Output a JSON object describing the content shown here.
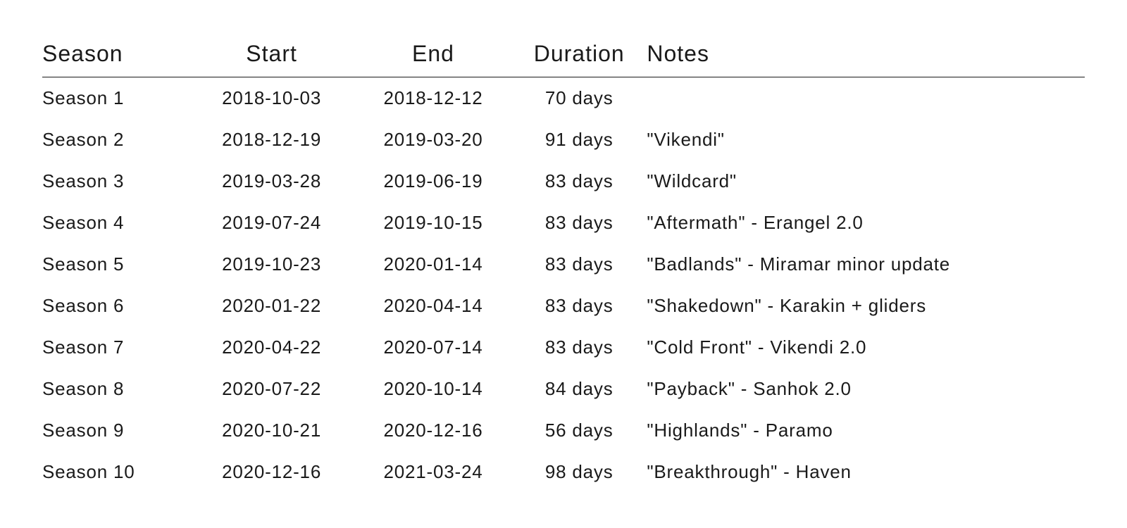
{
  "chart_data": {
    "type": "table",
    "columns": [
      "Season",
      "Start",
      "End",
      "Duration",
      "Notes"
    ],
    "rows": [
      [
        "Season 1",
        "2018-10-03",
        "2018-12-12",
        "70 days",
        ""
      ],
      [
        "Season 2",
        "2018-12-19",
        "2019-03-20",
        "91 days",
        "\"Vikendi\""
      ],
      [
        "Season 3",
        "2019-03-28",
        "2019-06-19",
        "83 days",
        "\"Wildcard\""
      ],
      [
        "Season 4",
        "2019-07-24",
        "2019-10-15",
        "83 days",
        "\"Aftermath\" - Erangel 2.0"
      ],
      [
        "Season 5",
        "2019-10-23",
        "2020-01-14",
        "83 days",
        "\"Badlands\" - Miramar minor update"
      ],
      [
        "Season 6",
        "2020-01-22",
        "2020-04-14",
        "83 days",
        "\"Shakedown\" - Karakin + gliders"
      ],
      [
        "Season 7",
        "2020-04-22",
        "2020-07-14",
        "83 days",
        "\"Cold Front\" - Vikendi 2.0"
      ],
      [
        "Season 8",
        "2020-07-22",
        "2020-10-14",
        "84 days",
        "\"Payback\" - Sanhok 2.0"
      ],
      [
        "Season 9",
        "2020-10-21",
        "2020-12-16",
        "56 days",
        "\"Highlands\" - Paramo"
      ],
      [
        "Season 10",
        "2020-12-16",
        "2021-03-24",
        "98 days",
        "\"Breakthrough\" - Haven"
      ]
    ]
  },
  "headers": {
    "season": "Season",
    "start": "Start",
    "end": "End",
    "duration": "Duration",
    "notes": "Notes"
  },
  "rows": [
    {
      "season": "Season 1",
      "start": "2018-10-03",
      "end": "2018-12-12",
      "duration": "70 days",
      "notes": ""
    },
    {
      "season": "Season 2",
      "start": "2018-12-19",
      "end": "2019-03-20",
      "duration": "91 days",
      "notes": "\"Vikendi\""
    },
    {
      "season": "Season 3",
      "start": "2019-03-28",
      "end": "2019-06-19",
      "duration": "83 days",
      "notes": "\"Wildcard\""
    },
    {
      "season": "Season 4",
      "start": "2019-07-24",
      "end": "2019-10-15",
      "duration": "83 days",
      "notes": "\"Aftermath\" - Erangel 2.0"
    },
    {
      "season": "Season 5",
      "start": "2019-10-23",
      "end": "2020-01-14",
      "duration": "83 days",
      "notes": "\"Badlands\" - Miramar minor update"
    },
    {
      "season": "Season 6",
      "start": "2020-01-22",
      "end": "2020-04-14",
      "duration": "83 days",
      "notes": "\"Shakedown\" - Karakin + gliders"
    },
    {
      "season": "Season 7",
      "start": "2020-04-22",
      "end": "2020-07-14",
      "duration": "83 days",
      "notes": "\"Cold Front\" - Vikendi 2.0"
    },
    {
      "season": "Season 8",
      "start": "2020-07-22",
      "end": "2020-10-14",
      "duration": "84 days",
      "notes": "\"Payback\" - Sanhok 2.0"
    },
    {
      "season": "Season 9",
      "start": "2020-10-21",
      "end": "2020-12-16",
      "duration": "56 days",
      "notes": "\"Highlands\" - Paramo"
    },
    {
      "season": "Season 10",
      "start": "2020-12-16",
      "end": "2021-03-24",
      "duration": "98 days",
      "notes": "\"Breakthrough\" - Haven"
    }
  ]
}
